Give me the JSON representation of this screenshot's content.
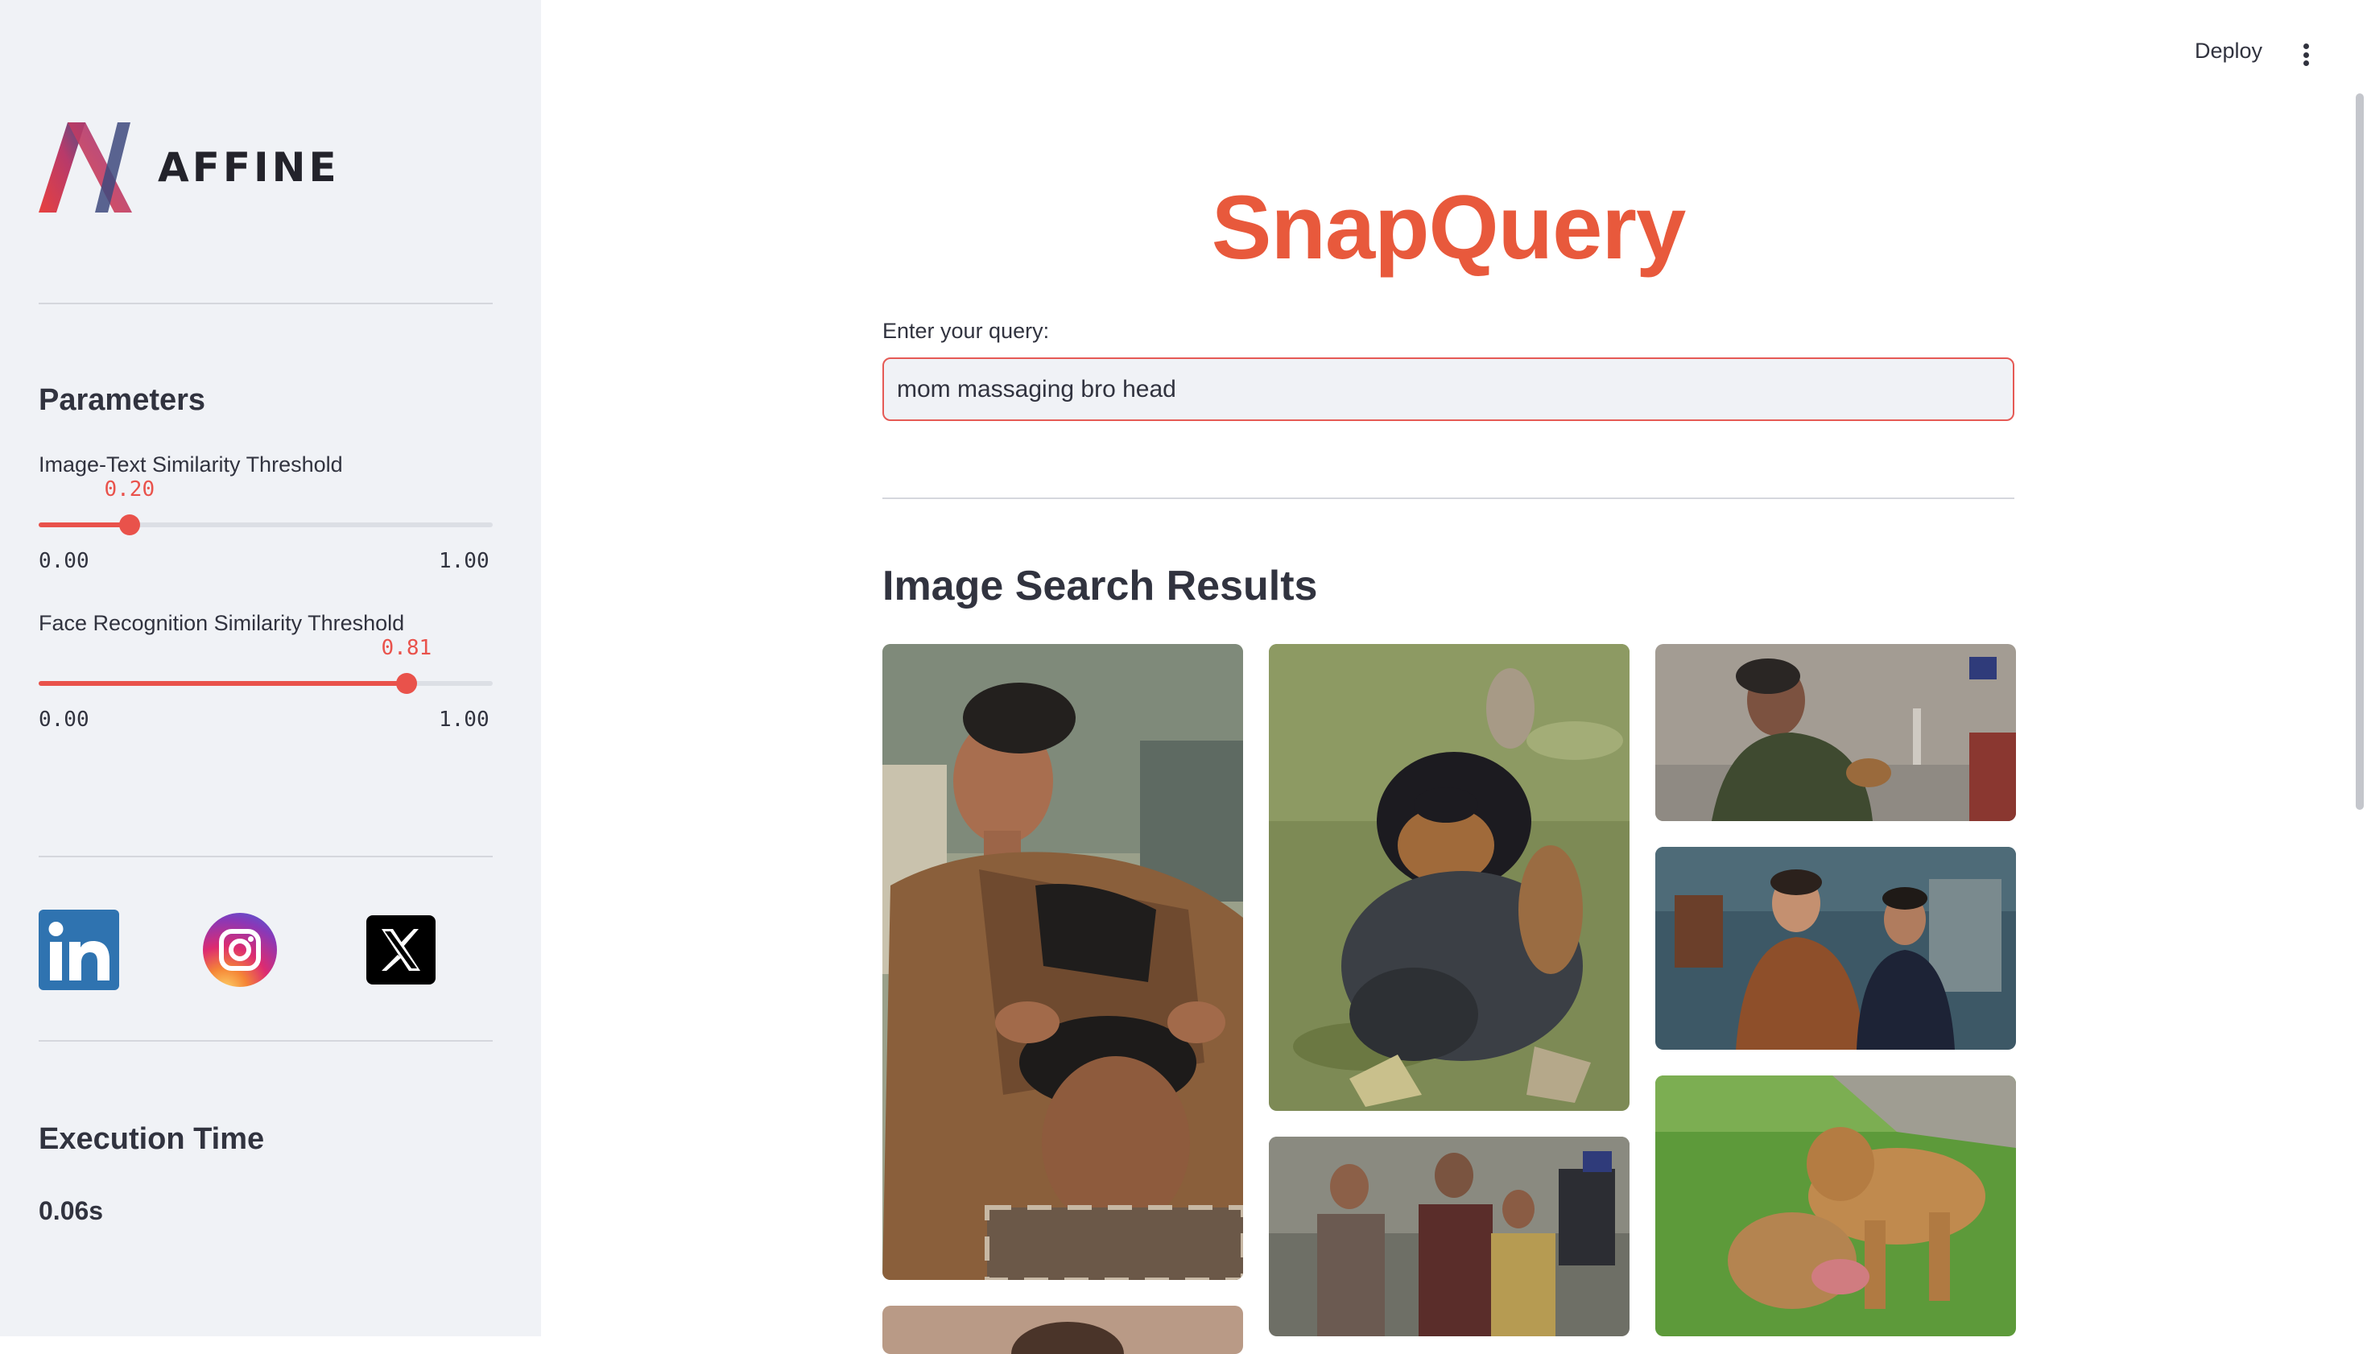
{
  "sidebar": {
    "brand": "AFFINE",
    "parameters_heading": "Parameters",
    "sliders": [
      {
        "label": "Image-Text Similarity Threshold",
        "value": 0.2,
        "value_text": "0.20",
        "min_text": "0.00",
        "max_text": "1.00"
      },
      {
        "label": "Face Recognition Similarity Threshold",
        "value": 0.81,
        "value_text": "0.81",
        "min_text": "0.00",
        "max_text": "1.00"
      }
    ],
    "social": [
      {
        "name": "LinkedIn",
        "glyph": "in"
      },
      {
        "name": "Instagram"
      },
      {
        "name": "X"
      }
    ],
    "execution_heading": "Execution Time",
    "execution_value": "0.06s"
  },
  "topbar": {
    "deploy_label": "Deploy"
  },
  "main": {
    "title": "SnapQuery",
    "query_label": "Enter your query:",
    "query_value": "mom massaging bro head",
    "results_heading": "Image Search Results"
  },
  "colors": {
    "accent": "#e9524b",
    "title": "#e8593c",
    "sidebar_bg": "#f0f2f6",
    "text": "#31333f"
  }
}
